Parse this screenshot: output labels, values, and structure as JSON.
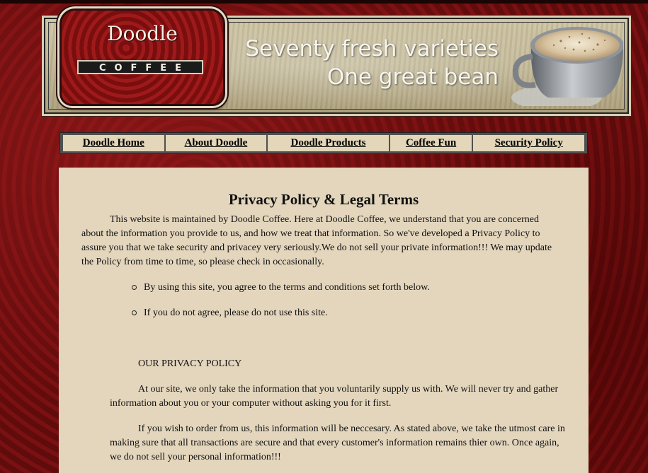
{
  "brand": {
    "logo_word": "Doodle",
    "logo_sub": "COFFEE",
    "tagline_line1": "Seventy fresh varieties",
    "tagline_line2": "One great bean"
  },
  "nav": {
    "items": [
      {
        "label": "Doodle Home"
      },
      {
        "label": "About Doodle"
      },
      {
        "label": "Doodle Products"
      },
      {
        "label": "Coffee Fun"
      },
      {
        "label": "Security Policy"
      }
    ]
  },
  "content": {
    "title": "Privacy Policy & Legal Terms",
    "intro": "This website is maintained by Doodle Coffee. Here at Doodle Coffee, we understand that you are concerned about the information you provide to us, and how we treat that information. So we've developed a Privacy Policy to assure you that we take security and privacey very seriously.We do not sell your private information!!! We may update the Policy from time to time, so please check in occasionally.",
    "bullets": [
      "By using this site, you agree to the terms and conditions set forth below.",
      "If you do not agree, please do not use this site."
    ],
    "section_heading": "OUR PRIVACY POLICY",
    "paragraphs": [
      "At our site, we only take the information that you voluntarily supply us with. We will never try and gather information about you or your computer without asking you for it first.",
      "If you wish to order from us, this information will be neccesary. As stated above, we take the utmost care in making sure that all transactions are secure and that every customer's information remains thier own. Once again, we do not sell your personal information!!!"
    ]
  },
  "colors": {
    "page_background": "#6e0e10",
    "content_background": "#e3d6bd",
    "nav_background": "#505050",
    "nav_item_background": "#e3d6b9",
    "logo_red": "#8c1414"
  }
}
